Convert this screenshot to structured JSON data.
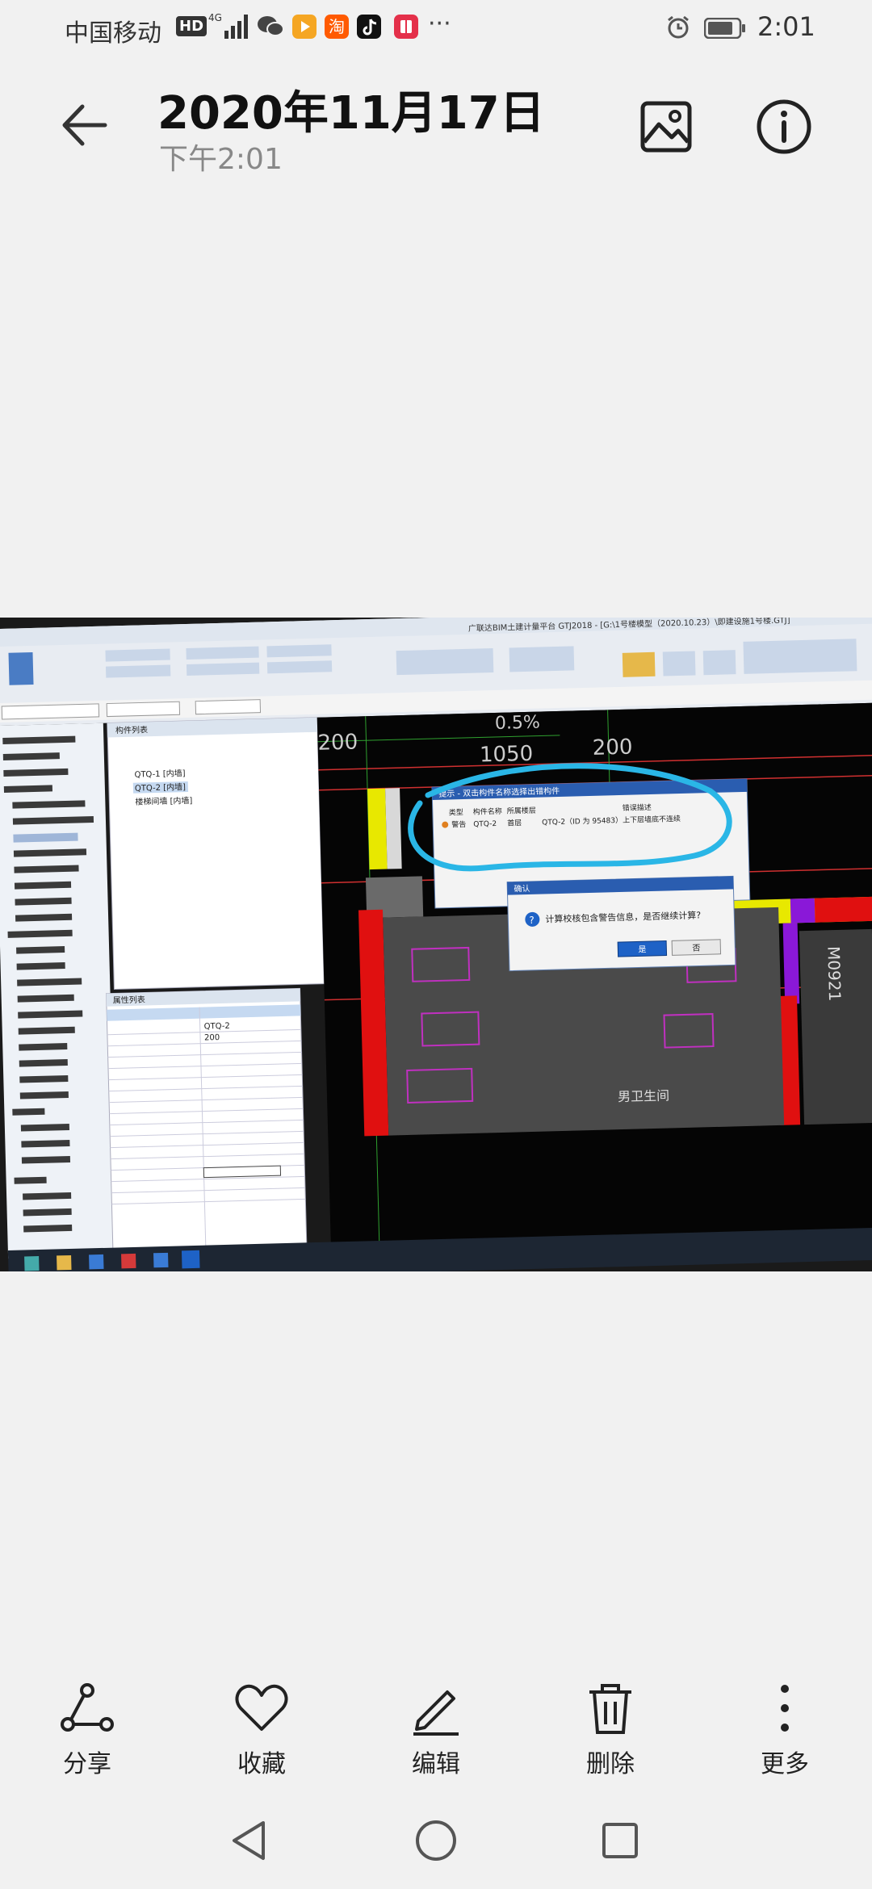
{
  "status_bar": {
    "carrier": "中国移动",
    "hd_badge": "HD",
    "network": "4G",
    "overflow": "···",
    "time": "2:01"
  },
  "header": {
    "title": "2020年11月17日",
    "subtitle": "下午2:01"
  },
  "photo": {
    "app_title": "广联达BIM土建计量平台 GTJ2018 - [G:\\1号楼模型（2020.10.23）\\即建设施1号楼.GTJ]",
    "dialog_title": "提示 - 双击构件名称选择出错构件",
    "dialog_cols": [
      "类型",
      "构件名称",
      "所属楼层",
      "错误描述"
    ],
    "dialog_row": [
      "警告",
      "QTQ-2",
      "首层",
      "QTQ-2（ID 为 95483）上下层墙底不连续"
    ],
    "confirm_title": "确认",
    "confirm_msg": "计算校核包含警告信息，是否继续计算?",
    "yes_label": "是",
    "no_label": "否",
    "label_room": "男卫生间",
    "label_door": "M0921",
    "dim_1050": "1050",
    "dim_200": "200",
    "slope": "0.5%",
    "left_panel_title": "构件列表",
    "comp_items": [
      "QTQ-1 [内墙]",
      "QTQ-2 [内墙]",
      "楼梯间墙 [内墙]"
    ],
    "props_title": "属性列表",
    "prop_name": "QTQ-2",
    "prop_thick": "200"
  },
  "actions": [
    {
      "label": "分享",
      "icon": "share-icon"
    },
    {
      "label": "收藏",
      "icon": "heart-icon"
    },
    {
      "label": "编辑",
      "icon": "edit-icon"
    },
    {
      "label": "删除",
      "icon": "trash-icon"
    },
    {
      "label": "更多",
      "icon": "more-icon"
    }
  ],
  "colors": {
    "background": "#f1f1f1",
    "highlight_circle": "#2ab6e6",
    "dialog_blue": "#1e62c6"
  }
}
